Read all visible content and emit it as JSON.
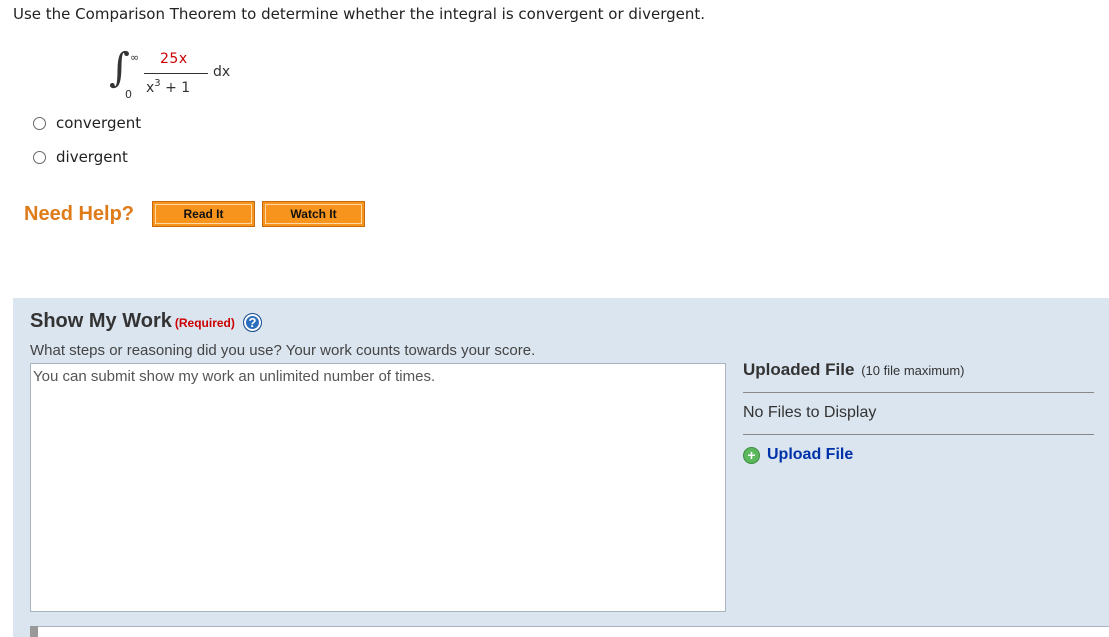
{
  "question": {
    "text": "Use the Comparison Theorem to determine whether the integral is convergent or divergent."
  },
  "integral": {
    "sign": "∫",
    "upper_limit": "∞",
    "lower_limit": "0",
    "numerator": "25x",
    "denominator_base": "x",
    "denominator_exponent": "3",
    "denominator_rest": " + 1",
    "differential": "dx",
    "numerator_color": "#cc0000"
  },
  "options": [
    {
      "label": "convergent",
      "selected": false
    },
    {
      "label": "divergent",
      "selected": false
    }
  ],
  "help": {
    "label": "Need Help?",
    "read_it": "Read It",
    "watch_it": "Watch It",
    "accent_color": "#e07b1a"
  },
  "show_my_work": {
    "title": "Show My Work",
    "required": "(Required)",
    "help_icon": "?",
    "description": "What steps or reasoning did you use? Your work counts towards your score.",
    "placeholder": "You can submit show my work an unlimited number of times."
  },
  "uploads": {
    "title": "Uploaded File",
    "max_note": "(10 file maximum)",
    "empty_text": "No Files to Display",
    "upload_label": "Upload File",
    "upload_icon": "plus-circle-icon"
  }
}
